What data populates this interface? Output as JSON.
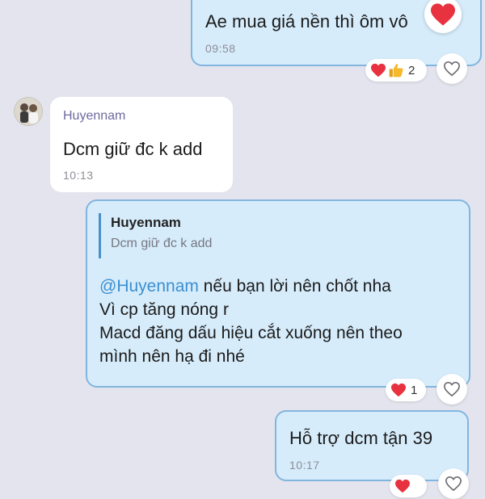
{
  "messages": [
    {
      "text": "Ae mua giá nền thì ôm vô",
      "time": "09:58",
      "reaction_count": "2"
    },
    {
      "sender": "Huyennam",
      "text": "Dcm giữ đc k add",
      "time": "10:13"
    },
    {
      "reply_to_name": "Huyennam",
      "reply_to_text": "Dcm giữ đc k add",
      "mention": "@Huyennam",
      "line1_rest": " nếu bạn lời nên chốt nha",
      "line2": "Vì cp tăng nóng r",
      "line3": "Macd đăng dấu hiệu cắt xuống nên theo",
      "line4": "mình nên hạ đi nhé",
      "reaction_count": "1"
    },
    {
      "text": "Hỗ trợ dcm tận 39",
      "time": "10:17"
    }
  ],
  "colors": {
    "background": "#e4e4ee",
    "my_bubble": "#d6ecfb",
    "my_bubble_border": "#82b5de",
    "their_bubble": "#ffffff",
    "mention": "#3b8fd1",
    "heart": "#e8323f",
    "thumbs": "#f5b92b"
  },
  "icons": {
    "heart": "heart-icon",
    "thumbs_up": "thumbs-up-icon",
    "heart_outline": "heart-outline-icon",
    "avatar": "avatar"
  }
}
